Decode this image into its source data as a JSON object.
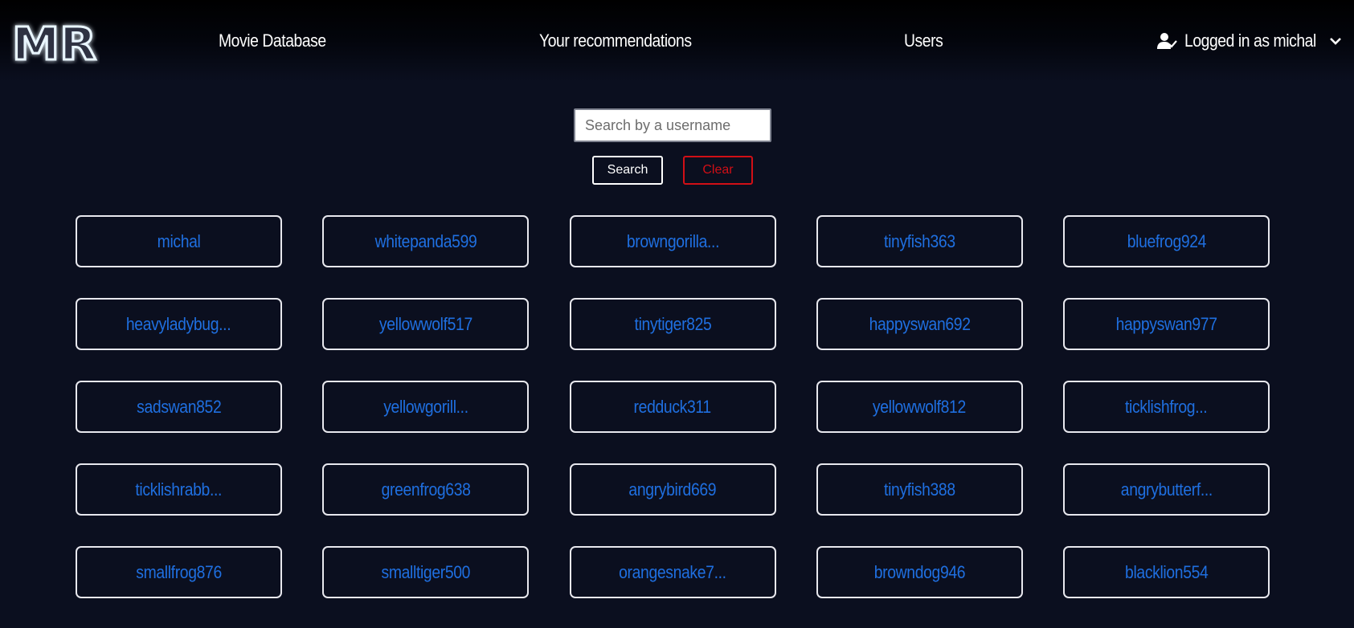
{
  "brand": {
    "logo_text": "MR"
  },
  "nav": {
    "links": [
      {
        "label": "Movie Database"
      },
      {
        "label": "Your recommendations"
      },
      {
        "label": "Users"
      }
    ],
    "user_menu": {
      "label": "Logged in as michal",
      "icon": "user-check-icon",
      "caret_icon": "chevron-down-icon"
    }
  },
  "search": {
    "placeholder": "Search by a username",
    "value": "",
    "search_label": "Search",
    "clear_label": "Clear"
  },
  "colors": {
    "background": "#0b0f1f",
    "username_link": "#1f6fe0",
    "clear_button": "#d10f16",
    "card_border": "#e8e8ee"
  },
  "users": [
    "michal",
    "whitepanda599",
    "browngorilla...",
    "tinyfish363",
    "bluefrog924",
    "heavyladybug...",
    "yellowwolf517",
    "tinytiger825",
    "happyswan692",
    "happyswan977",
    "sadswan852",
    "yellowgorill...",
    "redduck311",
    "yellowwolf812",
    "ticklishfrog...",
    "ticklishrabb...",
    "greenfrog638",
    "angrybird669",
    "tinyfish388",
    "angrybutterf...",
    "smallfrog876",
    "smalltiger500",
    "orangesnake7...",
    "browndog946",
    "blacklion554"
  ]
}
